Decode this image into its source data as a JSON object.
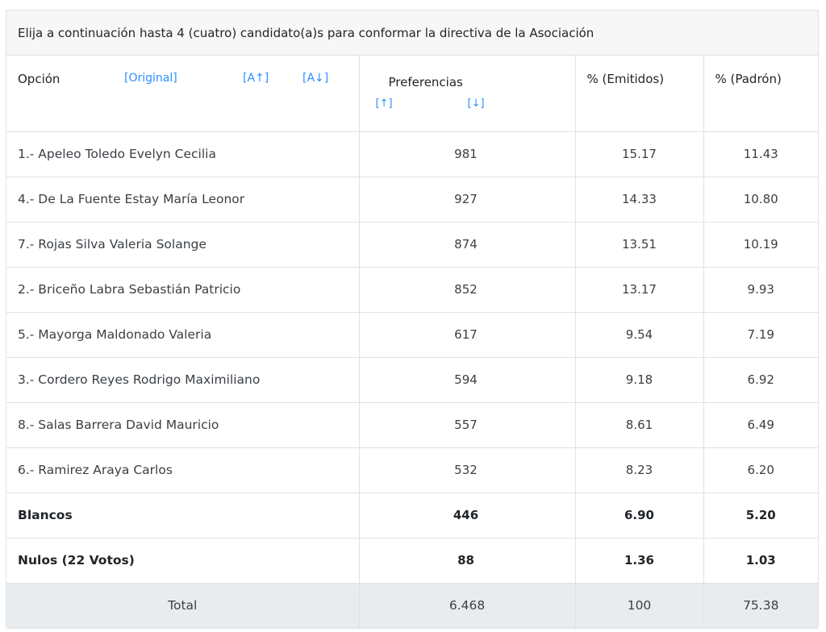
{
  "panel": {
    "title": "Elija a continuación hasta 4 (cuatro) candidato(a)s para conformar la directiva de la Asociación"
  },
  "header": {
    "option_label": "Opción",
    "sort_original": "[Original]",
    "sort_alpha_asc": "[A↑]",
    "sort_alpha_desc": "[A↓]",
    "preferences_label": "Preferencias",
    "sort_pref_asc": "[↑]",
    "sort_pref_desc": "[↓]",
    "pct_emitted_label": "% (Emitidos)",
    "pct_roll_label": "% (Padrón)"
  },
  "rows": [
    {
      "option": "1.- Apeleo Toledo Evelyn Cecilia",
      "preferences": "981",
      "pct_emitted": "15.17",
      "pct_roll": "11.43"
    },
    {
      "option": "4.- De La Fuente Estay María Leonor",
      "preferences": "927",
      "pct_emitted": "14.33",
      "pct_roll": "10.80"
    },
    {
      "option": "7.- Rojas Silva Valeria Solange",
      "preferences": "874",
      "pct_emitted": "13.51",
      "pct_roll": "10.19"
    },
    {
      "option": "2.- Briceño Labra Sebastián Patricio",
      "preferences": "852",
      "pct_emitted": "13.17",
      "pct_roll": "9.93"
    },
    {
      "option": "5.- Mayorga Maldonado Valeria",
      "preferences": "617",
      "pct_emitted": "9.54",
      "pct_roll": "7.19"
    },
    {
      "option": "3.- Cordero Reyes Rodrigo Maximiliano",
      "preferences": "594",
      "pct_emitted": "9.18",
      "pct_roll": "6.92"
    },
    {
      "option": "8.- Salas Barrera David Mauricio",
      "preferences": "557",
      "pct_emitted": "8.61",
      "pct_roll": "6.49"
    },
    {
      "option": "6.- Ramirez Araya Carlos",
      "preferences": "532",
      "pct_emitted": "8.23",
      "pct_roll": "6.20"
    },
    {
      "option": "Blancos",
      "preferences": "446",
      "pct_emitted": "6.90",
      "pct_roll": "5.20"
    },
    {
      "option": "Nulos (22 Votos)",
      "preferences": "88",
      "pct_emitted": "1.36",
      "pct_roll": "1.03"
    }
  ],
  "total": {
    "label": "Total",
    "preferences": "6.468",
    "pct_emitted": "100",
    "pct_roll": "75.38"
  },
  "colors": {
    "link": "#2c8fff",
    "header_bg": "#f7f7f7",
    "total_bg": "#e9ecef",
    "border": "#dee2e6"
  }
}
